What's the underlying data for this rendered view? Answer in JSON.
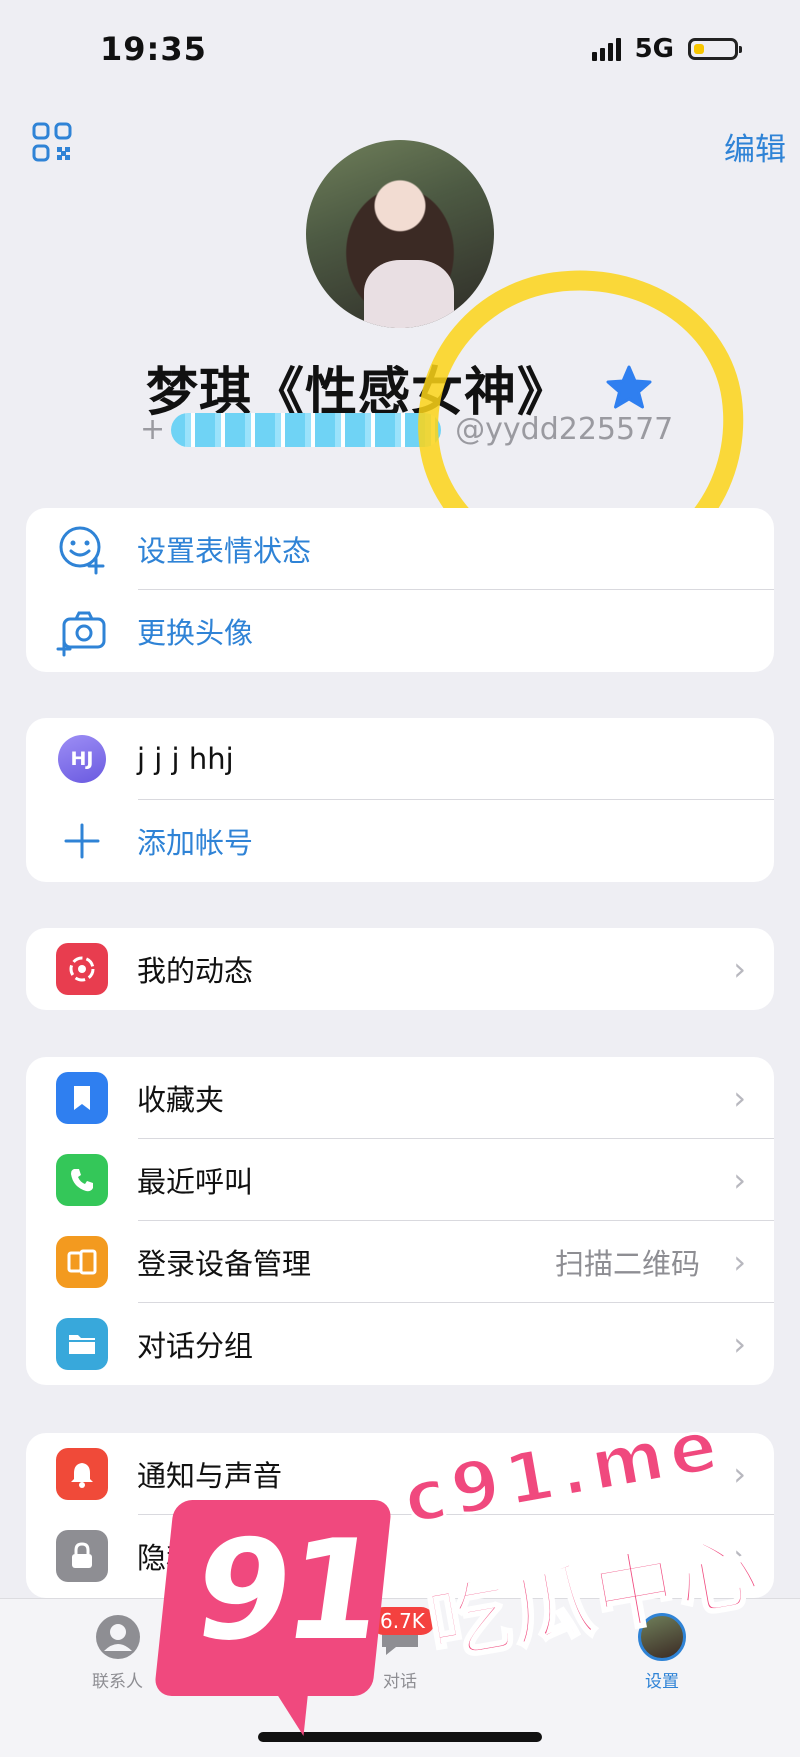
{
  "status_bar": {
    "time": "19:35",
    "network": "5G"
  },
  "header": {
    "edit_label": "编辑"
  },
  "profile": {
    "name": "梦琪《性感女神》",
    "phone_prefix": "+",
    "username": "@yydd225577"
  },
  "card1": [
    {
      "icon": "emoji-status-icon",
      "label": "设置表情状态"
    },
    {
      "icon": "camera-icon",
      "label": "更换头像"
    }
  ],
  "accounts": {
    "current": {
      "initials": "HJ",
      "name": "j j j hhj"
    },
    "add_label": "添加帐号"
  },
  "card3": [
    {
      "icon": "stories-icon",
      "label": "我的动态",
      "color": "#e83d4f"
    }
  ],
  "card4": [
    {
      "icon": "bookmark-icon",
      "label": "收藏夹",
      "color": "#2f7ff0"
    },
    {
      "icon": "phone-icon",
      "label": "最近呼叫",
      "color": "#34c759"
    },
    {
      "icon": "devices-icon",
      "label": "登录设备管理",
      "right_text": "扫描二维码",
      "color": "#f39a1f"
    },
    {
      "icon": "folder-icon",
      "label": "对话分组",
      "color": "#38a8db"
    }
  ],
  "card5": [
    {
      "icon": "bell-icon",
      "label": "通知与声音",
      "color": "#f04a39"
    },
    {
      "icon": "lock-icon",
      "label": "隐私与安全",
      "color": "#8e8e93"
    }
  ],
  "tabbar": {
    "contacts_label": "联系人",
    "chats_label": "对话",
    "chats_badge": "6.7K",
    "settings_label": "设置"
  },
  "watermark": {
    "number": "91",
    "site": "c91.me",
    "name": "吃瓜中心"
  }
}
